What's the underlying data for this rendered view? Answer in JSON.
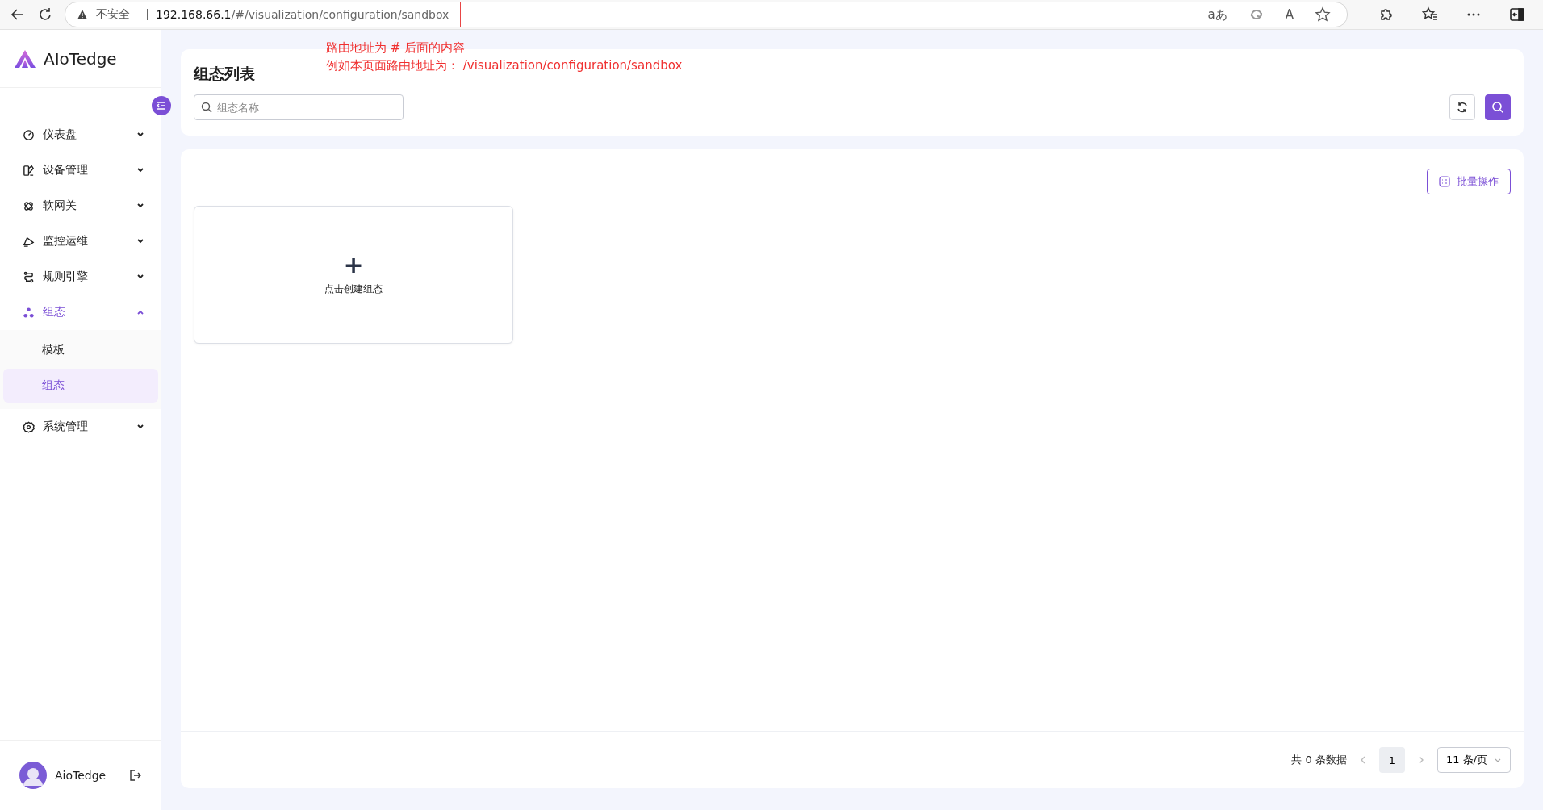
{
  "browser": {
    "security_label": "不安全",
    "url_host": "192.168.66.1",
    "url_path": "/#/visualization/configuration/sandbox",
    "translate_glyph": "aあ",
    "read_aloud_glyph": "A"
  },
  "annotation": {
    "lines": [
      "路由地址为 # 后面的内容",
      "例如本页面路由地址为：  /visualization/configuration/sandbox"
    ]
  },
  "sidebar": {
    "logo": "AIoTedge",
    "items": [
      {
        "label": "仪表盘",
        "kind": "gauge",
        "expanded": false,
        "selected": false
      },
      {
        "label": "设备管理",
        "kind": "device",
        "expanded": false,
        "selected": false
      },
      {
        "label": "软网关",
        "kind": "gateway",
        "expanded": false,
        "selected": false
      },
      {
        "label": "监控运维",
        "kind": "monitor",
        "expanded": false,
        "selected": false
      },
      {
        "label": "规则引擎",
        "kind": "rules",
        "expanded": false,
        "selected": false
      },
      {
        "label": "组态",
        "kind": "config",
        "expanded": true,
        "selected": true,
        "children": [
          {
            "label": "模板",
            "selected": false
          },
          {
            "label": "组态",
            "selected": true
          }
        ]
      },
      {
        "label": "系统管理",
        "kind": "settings",
        "expanded": false,
        "selected": false
      }
    ],
    "user": {
      "name": "AioTedge"
    }
  },
  "header": {
    "title": "组态列表",
    "search": {
      "placeholder": "组态名称"
    }
  },
  "content": {
    "batch_button": "批量操作",
    "create_card": {
      "symbol": "+",
      "label": "点击创建组态"
    }
  },
  "pagination": {
    "total": "共 0 条数据",
    "pages": [
      {
        "label": "1",
        "selected": true
      }
    ],
    "page_size": "11 条/页"
  }
}
